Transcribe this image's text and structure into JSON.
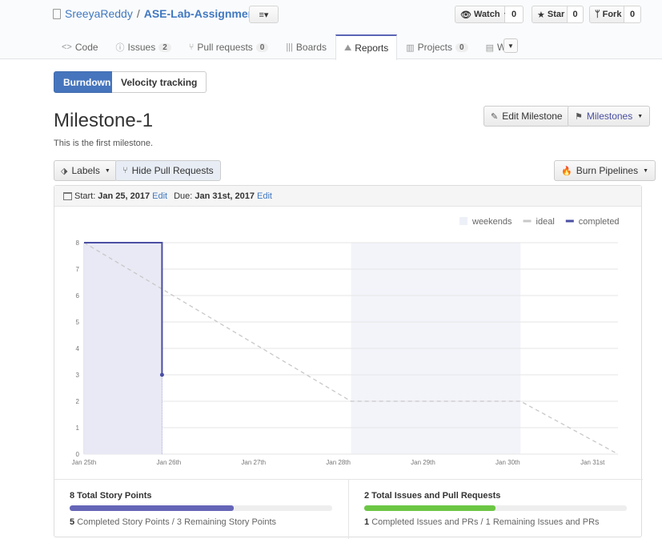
{
  "header": {
    "owner": "SreeyaReddy",
    "separator": "/",
    "repo": "ASE-Lab-Assignments",
    "list_icon": "≡▾",
    "watch": {
      "label": "Watch",
      "count": "0"
    },
    "star": {
      "label": "Star",
      "count": "0"
    },
    "fork": {
      "label": "Fork",
      "count": "0"
    }
  },
  "nav": {
    "tabs": [
      {
        "label": "Code",
        "icon": "code-icon"
      },
      {
        "label": "Issues",
        "count": "2",
        "icon": "issue-icon"
      },
      {
        "label": "Pull requests",
        "count": "0",
        "icon": "pull-request-icon"
      },
      {
        "label": "Boards",
        "icon": "boards-icon"
      },
      {
        "label": "Reports",
        "icon": "graph-icon"
      },
      {
        "label": "Projects",
        "count": "0",
        "icon": "project-icon"
      },
      {
        "label": "Wiki",
        "icon": "book-icon"
      }
    ],
    "active": "Reports"
  },
  "report_tabs": {
    "burndown": "Burndown",
    "velocity": "Velocity tracking"
  },
  "milestone": {
    "title": "Milestone-1",
    "description": "This is the first milestone.",
    "edit_label": "Edit Milestone",
    "milestones_label": "Milestones"
  },
  "filters": {
    "labels": "Labels",
    "hide_prs": "Hide Pull Requests",
    "burn_pipelines": "Burn Pipelines"
  },
  "dates": {
    "start_label": "Start:",
    "start": "Jan 25, 2017",
    "due_label": "Due:",
    "due": "Jan 31st, 2017",
    "edit": "Edit"
  },
  "chart_data": {
    "type": "line",
    "legend": [
      {
        "name": "weekends",
        "color": "#eef0f8"
      },
      {
        "name": "ideal",
        "color": "#c8c8c8"
      },
      {
        "name": "completed",
        "color": "#4b4fa3"
      }
    ],
    "legend_position": "top-right",
    "x_ticks": [
      "Jan 25th",
      "Jan 26th",
      "Jan 27th",
      "Jan 28th",
      "Jan 29th",
      "Jan 30th",
      "Jan 31st"
    ],
    "y_ticks": [
      0,
      1,
      2,
      3,
      4,
      5,
      6,
      7,
      8
    ],
    "ylim": [
      0,
      8
    ],
    "xlim": [
      0,
      6.3
    ],
    "grid": true,
    "weekend_bands": [
      [
        3.15,
        5.15
      ]
    ],
    "series": [
      {
        "name": "ideal",
        "style": "dashed",
        "color": "#c8c8c8",
        "points": [
          [
            0,
            8
          ],
          [
            3.15,
            2
          ],
          [
            5.15,
            2
          ],
          [
            6.3,
            0
          ]
        ]
      },
      {
        "name": "completed",
        "style": "solid",
        "color": "#4b4fa3",
        "points": [
          [
            0,
            8
          ],
          [
            0.92,
            8
          ],
          [
            0.92,
            3
          ]
        ],
        "shaded": true
      }
    ]
  },
  "stats": {
    "story_points": {
      "title": "8 Total Story Points",
      "completed": "5",
      "completed_text": "Completed Story Points",
      "separator": " / ",
      "remaining_text": "3 Remaining Story Points",
      "fraction": 0.625,
      "color": "#6565b8"
    },
    "issues": {
      "title": "2 Total Issues and Pull Requests",
      "completed": "1",
      "completed_text": "Completed Issues and PRs",
      "separator": " / ",
      "remaining_text": "1 Remaining Issues and PRs",
      "fraction": 0.5,
      "color": "#6cc644"
    }
  }
}
